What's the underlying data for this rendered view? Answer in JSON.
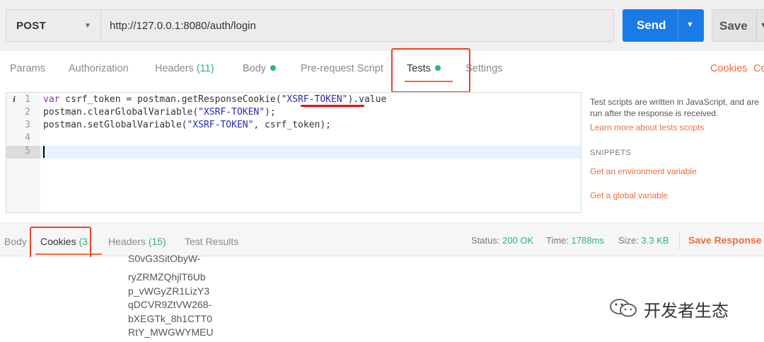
{
  "request": {
    "method": "POST",
    "url": "http://127.0.0.1:8080/auth/login",
    "send_label": "Send",
    "save_label": "Save"
  },
  "request_tabs": {
    "params": "Params",
    "authorization": "Authorization",
    "headers": "Headers",
    "headers_count": "(11)",
    "body": "Body",
    "prerequest": "Pre-request Script",
    "tests": "Tests",
    "settings": "Settings",
    "cookies": "Cookies",
    "code": "Co"
  },
  "editor": {
    "line_numbers": [
      "1",
      "2",
      "3",
      "4",
      "5"
    ],
    "info_marker": "i",
    "line1": {
      "kw": "var",
      "a": " csrf_token = postman.getResponseCookie(",
      "str": "\"XSRF-TOKEN\"",
      "b": ").value"
    },
    "line2": {
      "a": "postman.clearGlobalVariable(",
      "str": "\"XSRF-TOKEN\"",
      "b": ");"
    },
    "line3": {
      "a": "postman.setGlobalVariable(",
      "str": "\"XSRF-TOKEN\"",
      "b": ", csrf_token);"
    }
  },
  "side_help": {
    "description": "Test scripts are written in JavaScript, and are run after the response is received.",
    "learn_more": "Learn more about tests scripts",
    "snippets_heading": "SNIPPETS",
    "snippet1": "Get an environment variable",
    "snippet2": "Get a global variable"
  },
  "response_tabs": {
    "body": "Body",
    "cookies": "Cookies",
    "cookies_count": "(3",
    "headers": "Headers",
    "headers_count": "(15)",
    "test_results": "Test Results"
  },
  "response_status": {
    "status_label": "Status:",
    "status_value": "200 OK",
    "time_label": "Time:",
    "time_value": "1788ms",
    "size_label": "Size:",
    "size_value": "3.3 KB",
    "save_response": "Save Response"
  },
  "cookie_value_lines": [
    "S0vG3SitObyW-",
    "ryZRMZQhjlT6Ub",
    "p_vWGyZR1LizY3",
    "qDCVR9ZtVW268-",
    "bXEGTk_8h1CTT0",
    "RtY_MWGWYMEU"
  ],
  "watermark": "开发者生态",
  "colors": {
    "accent_orange": "#f26b3a",
    "send_blue": "#1a7be6",
    "green": "#2ab57d",
    "annotation_red": "#e8442a"
  }
}
